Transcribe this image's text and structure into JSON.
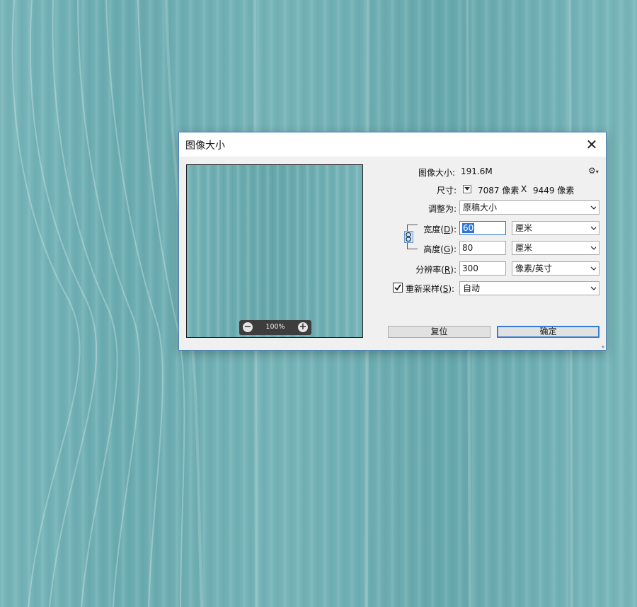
{
  "dialog": {
    "title": "图像大小",
    "close_glyph": "✕"
  },
  "preview": {
    "zoom": "100%",
    "zoom_out_glyph": "−",
    "zoom_in_glyph": "+"
  },
  "info": {
    "size_label": "图像大小:",
    "size_value": "191.6M",
    "gear_glyph": "⚙",
    "dims_label": "尺寸:",
    "dims_width": "7087 像素",
    "dims_x": "X",
    "dims_height": "9449 像素"
  },
  "fit_to": {
    "label": "调整为:",
    "value": "原稿大小"
  },
  "width": {
    "label_pre": "宽度(",
    "mnemonic": "D",
    "label_post": "):",
    "value": "60",
    "unit": "厘米"
  },
  "height": {
    "label_pre": "高度(",
    "mnemonic": "G",
    "label_post": "):",
    "value": "80",
    "unit": "厘米"
  },
  "resolution": {
    "label_pre": "分辨率(",
    "mnemonic": "R",
    "label_post": "):",
    "value": "300",
    "unit": "像素/英寸"
  },
  "resample": {
    "checked": true,
    "label_pre": "重新采样(",
    "mnemonic": "S",
    "label_post": "):",
    "value": "自动"
  },
  "buttons": {
    "reset": "复位",
    "ok": "确定"
  },
  "colors": {
    "backdrop_teal": "#6fb0b4",
    "dialog_border": "#4a7fbf",
    "focus_blue": "#2d76d6"
  }
}
